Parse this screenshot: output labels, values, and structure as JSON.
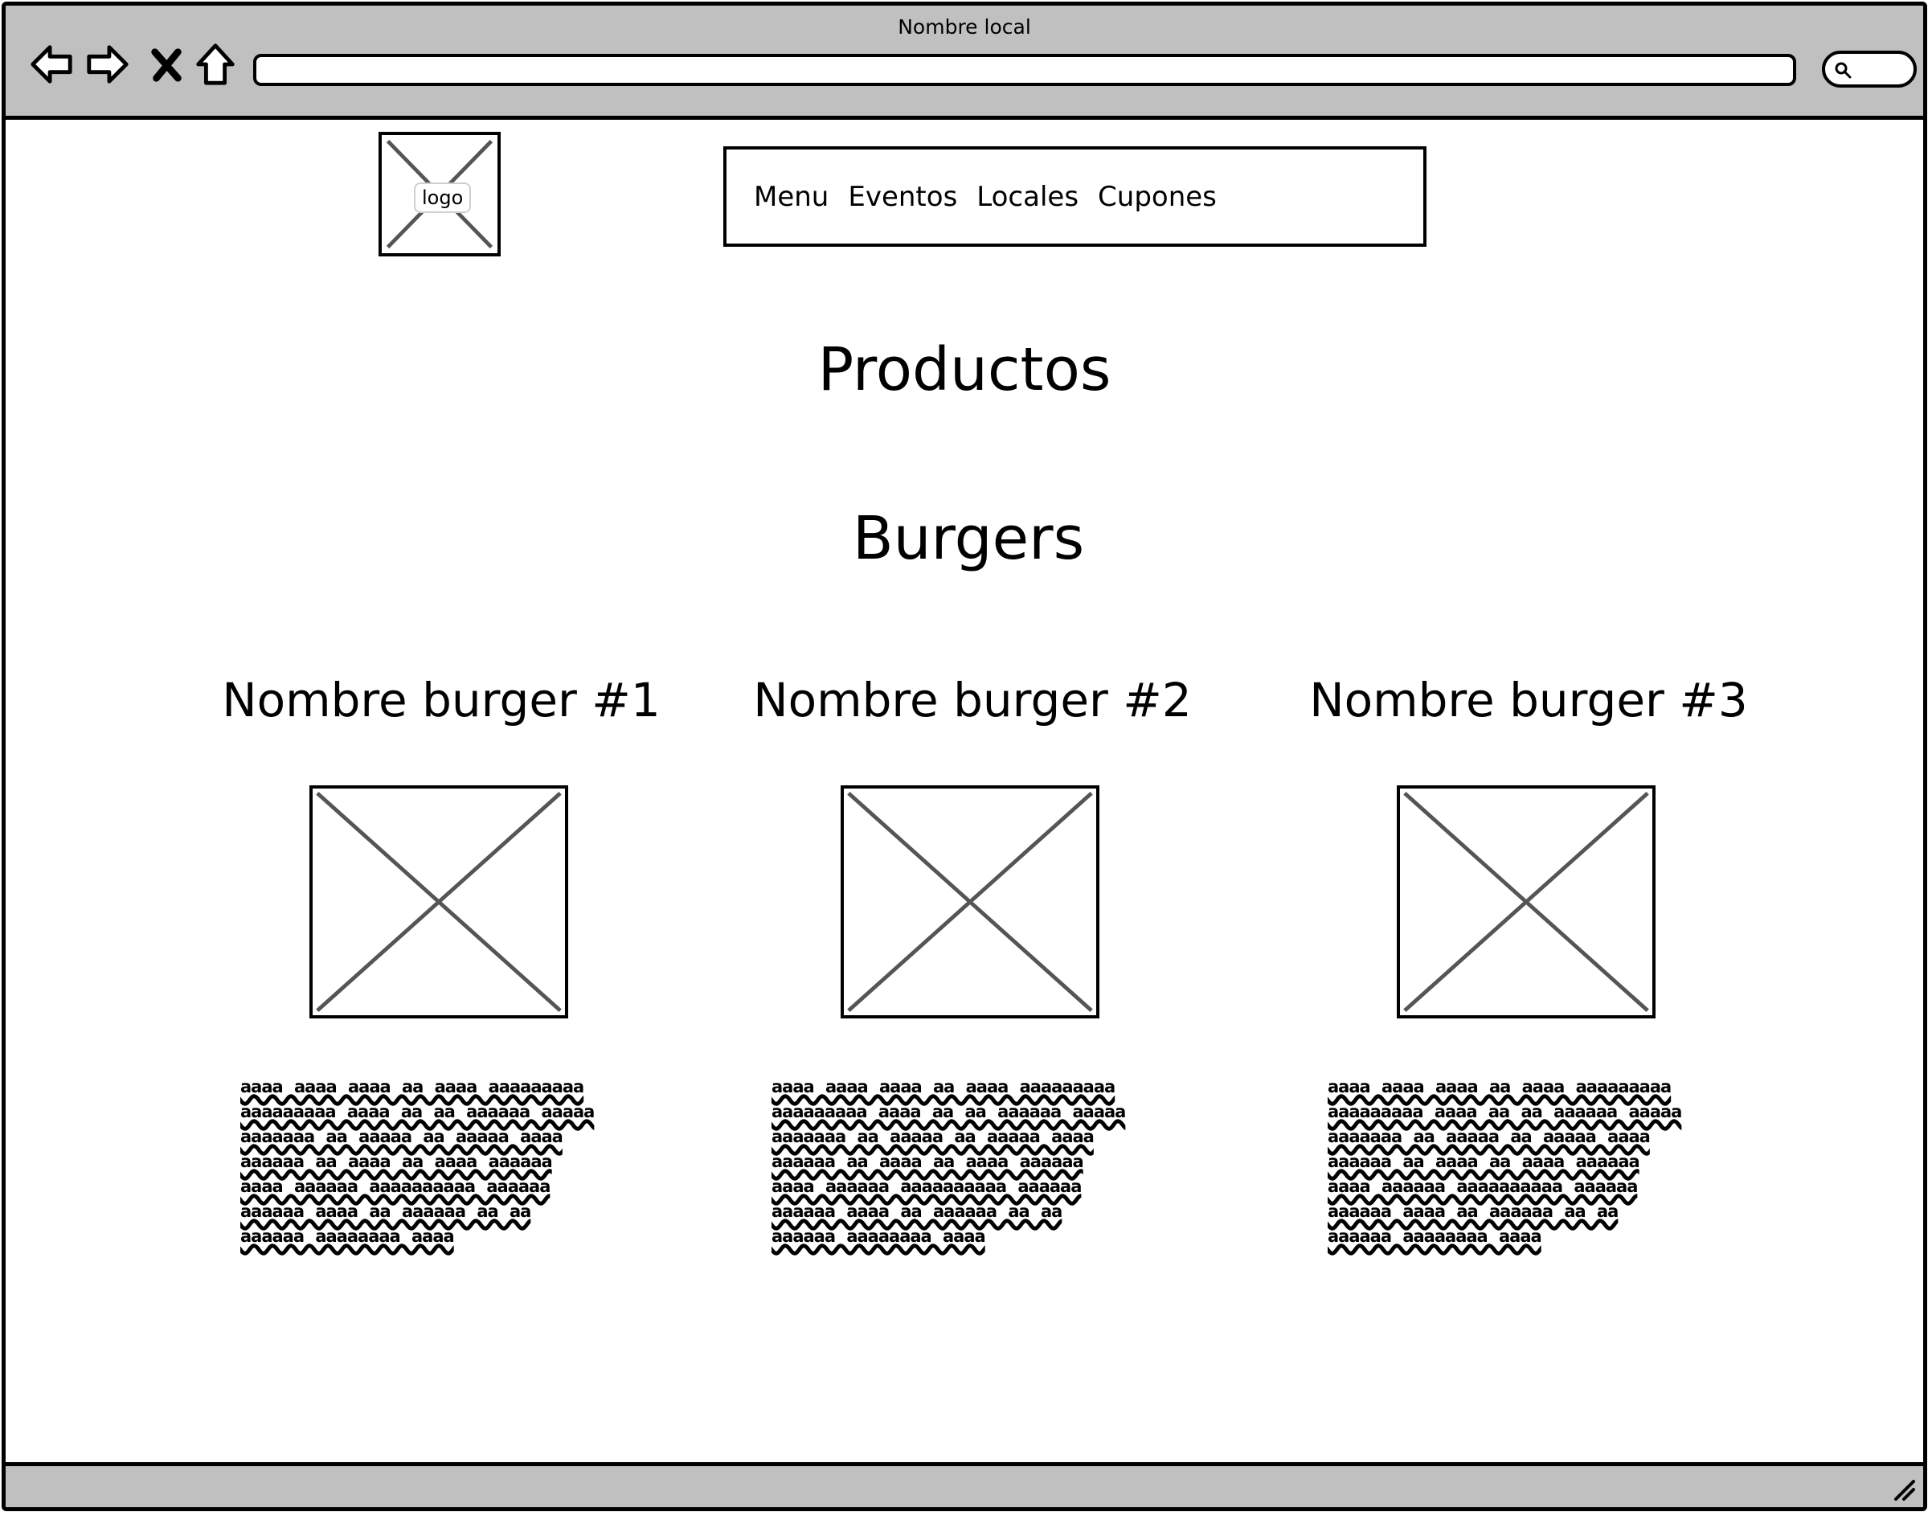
{
  "window": {
    "title": "Nombre local"
  },
  "browser": {
    "address": "",
    "icons": [
      "back-arrow-icon",
      "forward-arrow-icon",
      "close-x-icon",
      "home-icon",
      "search-icon"
    ]
  },
  "header": {
    "logo_label": "logo",
    "nav": [
      "Menu",
      "Eventos",
      "Locales",
      "Cupones"
    ]
  },
  "main": {
    "title": "Productos",
    "section_title": "Burgers",
    "products": [
      {
        "name": "Nombre burger #1",
        "description": "aaaa aaaa aaaa aa aaaa aaaaaaaaa aaaaaaaaa aaaa aa aa aaaaaa aaaaa aaaaaaa aa aaaaa aa aaaaa aaaa aaaaaa aa aaaa aa aaaa aaaaaa aaaa aaaaaa aaaaaaaaaa aaaaaa aaaaaa aaaa aa aaaaaa aa aa aaaaaa aaaaaaaa aaaa"
      },
      {
        "name": "Nombre burger #2",
        "description": "aaaa aaaa aaaa aa aaaa aaaaaaaaa aaaaaaaaa aaaa aa aa aaaaaa aaaaa aaaaaaa aa aaaaa aa aaaaa aaaa aaaaaa aa aaaa aa aaaa aaaaaa aaaa aaaaaa aaaaaaaaaa aaaaaa aaaaaa aaaa aa aaaaaa aa aa aaaaaa aaaaaaaa aaaa"
      },
      {
        "name": "Nombre burger #3",
        "description": "aaaa aaaa aaaa aa aaaa aaaaaaaaa aaaaaaaaa aaaa aa aa aaaaaa aaaaa aaaaaaa aa aaaaa aa aaaaa aaaa aaaaaa aa aaaa aa aaaa aaaaaa aaaa aaaaaa aaaaaaaaaa aaaaaa aaaaaa aaaa aa aaaaaa aa aa aaaaaa aaaaaaaa aaaa"
      }
    ]
  },
  "colors": {
    "chrome": "#c0c0c0",
    "stroke": "#000000",
    "placeholder_x": "#555555"
  }
}
